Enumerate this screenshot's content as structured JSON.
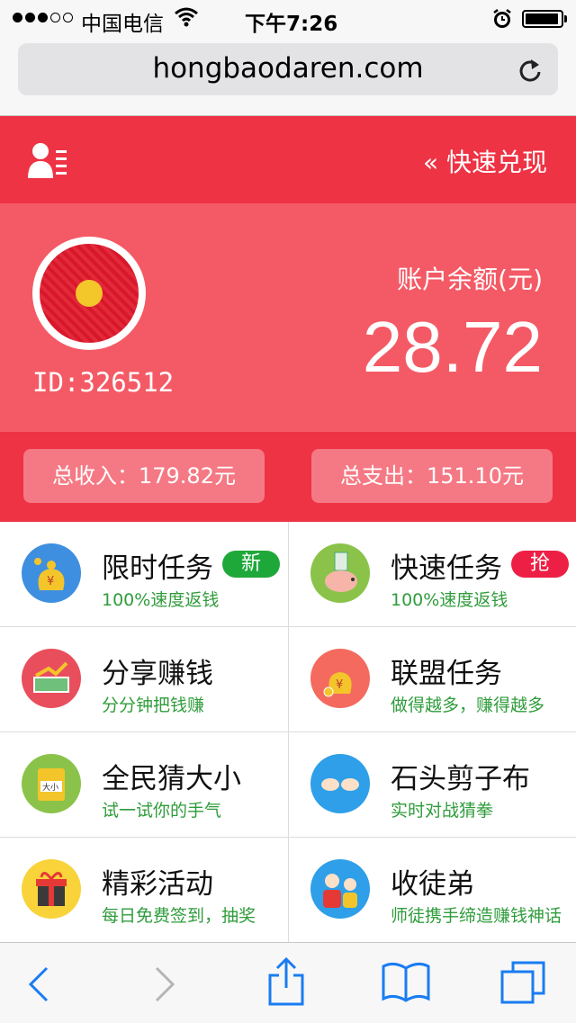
{
  "status_bar": {
    "carrier": "中国电信",
    "time": "下午7:26",
    "signal_bars": 3,
    "icons": [
      "wifi-icon",
      "alarm-icon",
      "battery-icon"
    ]
  },
  "browser": {
    "url": "hongbaodaren.com",
    "icons": [
      "reload-icon"
    ]
  },
  "header": {
    "cash_link": "« 快速兑现",
    "icons": [
      "user-list-icon"
    ]
  },
  "account": {
    "user_id": "ID:326512",
    "balance_label": "账户余额(元)",
    "balance": "28.72",
    "income": "总收入：179.82元",
    "expense": "总支出：151.10元"
  },
  "menu": [
    {
      "title": "限时任务",
      "subtitle": "100%速度返钱",
      "badge": "新",
      "icon": "money-bag-icon"
    },
    {
      "title": "快速任务",
      "subtitle": "100%速度返钱",
      "badge": "抢",
      "icon": "piggy-bank-icon"
    },
    {
      "title": "分享赚钱",
      "subtitle": "分分钟把钱赚",
      "badge": "",
      "icon": "cash-stack-icon"
    },
    {
      "title": "联盟任务",
      "subtitle": "做得越多，赚得越多",
      "badge": "",
      "icon": "coin-bag-icon"
    },
    {
      "title": "全民猜大小",
      "subtitle": "试一试你的手气",
      "badge": "",
      "icon": "slot-machine-icon"
    },
    {
      "title": "石头剪子布",
      "subtitle": "实时对战猜拳",
      "badge": "",
      "icon": "rock-paper-scissors-icon"
    },
    {
      "title": "精彩活动",
      "subtitle": "每日免费签到，抽奖",
      "badge": "",
      "icon": "gift-box-icon"
    },
    {
      "title": "收徒弟",
      "subtitle": "师徒携手缔造赚钱神话",
      "badge": "",
      "icon": "master-apprentice-icon"
    }
  ],
  "toolbar": {
    "icons": [
      "back-icon",
      "forward-icon",
      "share-icon",
      "bookmarks-icon",
      "tabs-icon"
    ]
  },
  "colors": {
    "header_red": "#ee3344",
    "card_red": "#f45a65",
    "subtitle_green": "#2f9c3b",
    "toolbar_blue": "#1a7cf2"
  }
}
